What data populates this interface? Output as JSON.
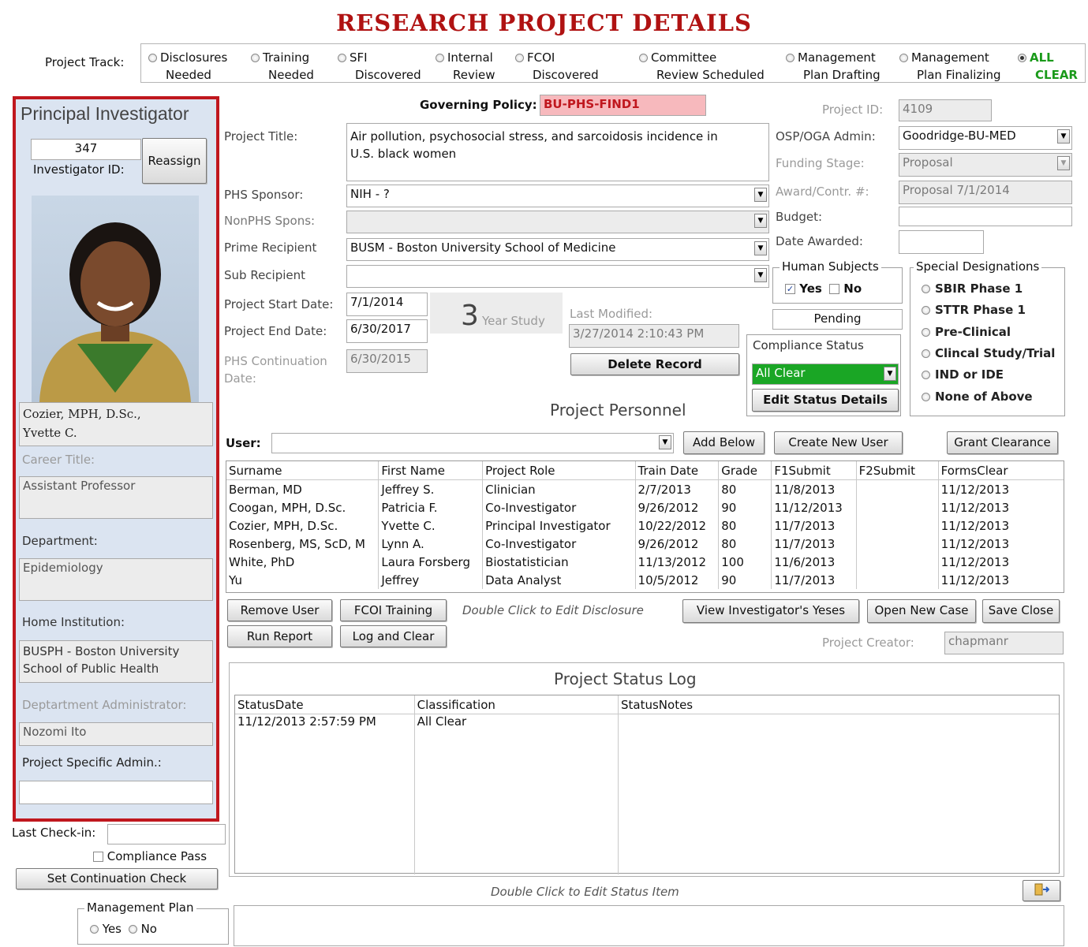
{
  "title": "RESEARCH PROJECT DETAILS",
  "colors": {
    "title_red": "#b01212",
    "frame_red": "#c0171e",
    "panel_blue": "#dbe4f1",
    "policy_pink": "#f7b9bd",
    "status_green": "#1aa625",
    "clear_green": "#1a9a1a"
  },
  "track": {
    "label": "Project Track:",
    "items": [
      {
        "line1": "Disclosures",
        "line2": "Needed",
        "selected": false
      },
      {
        "line1": "Training",
        "line2": "Needed",
        "selected": false
      },
      {
        "line1": "SFI",
        "line2": "Discovered",
        "selected": false
      },
      {
        "line1": "Internal",
        "line2": "Review",
        "selected": false
      },
      {
        "line1": "FCOI",
        "line2": "Discovered",
        "selected": false
      },
      {
        "line1": "Committee",
        "line2": "Review Scheduled",
        "selected": false
      },
      {
        "line1": "Management",
        "line2": "Plan Drafting",
        "selected": false
      },
      {
        "line1": "Management",
        "line2": "Plan Finalizing",
        "selected": false
      },
      {
        "line1": "ALL",
        "line2": "CLEAR",
        "selected": true
      }
    ]
  },
  "pi": {
    "heading": "Principal Investigator",
    "investigator_id": "347",
    "investigator_id_label": "Investigator ID:",
    "reassign": "Reassign",
    "name_line1": "Cozier, MPH, D.Sc.,",
    "name_line2": "Yvette C.",
    "career_title_label": "Career Title:",
    "career_title": "Assistant Professor",
    "department_label": "Department:",
    "department": "Epidemiology",
    "home_institution_label": "Home Institution:",
    "home_institution_line1": "BUSPH - Boston University",
    "home_institution_line2": "School of Public Health",
    "dept_admin_label": "Deptartment Administrator:",
    "dept_admin": "Nozomi Ito",
    "project_admin_label": "Project Specific Admin.:",
    "project_admin": ""
  },
  "left_footer": {
    "last_checkin_label": "Last Check-in:",
    "last_checkin": "",
    "compliance_pass": "Compliance Pass",
    "set_continuation": "Set Continuation Check",
    "mgmt_plan_legend": "Management Plan",
    "yes": "Yes",
    "no": "No"
  },
  "policy": {
    "label": "Governing Policy:",
    "value": "BU-PHS-FIND1"
  },
  "project": {
    "id_label": "Project ID:",
    "id": "4109",
    "title_label": "Project Title:",
    "title_line1": "Air pollution, psychosocial stress, and sarcoidosis incidence in",
    "title_line2": "U.S. black women",
    "phs_sponsor_label": "PHS Sponsor:",
    "phs_sponsor": "NIH - ?",
    "nonphs_label": "NonPHS Spons:",
    "nonphs": "",
    "prime_label": "Prime Recipient",
    "prime": "BUSM - Boston University School of Medicine",
    "sub_label": "Sub Recipient",
    "sub": "",
    "start_label": "Project Start Date:",
    "start": "7/1/2014",
    "end_label": "Project End Date:",
    "end": "6/30/2017",
    "cont_label_1": "PHS Continuation",
    "cont_label_2": "Date:",
    "cont": "6/30/2015",
    "years": "3",
    "years_label": "Year Study",
    "last_modified_label": "Last Modified:",
    "last_modified": "3/27/2014 2:10:43 PM",
    "delete": "Delete Record"
  },
  "admin": {
    "osp_label": "OSP/OGA Admin:",
    "osp": "Goodridge-BU-MED",
    "funding_label": "Funding Stage:",
    "funding": "Proposal",
    "award_label": "Award/Contr. #:",
    "award": "Proposal 7/1/2014",
    "budget_label": "Budget:",
    "budget": "",
    "awarded_label": "Date Awarded:",
    "awarded": ""
  },
  "human_subjects": {
    "legend": "Human Subjects",
    "yes": "Yes",
    "no": "No",
    "yes_checked": true,
    "no_checked": false,
    "status": "Pending"
  },
  "compliance": {
    "legend": "Compliance Status",
    "value": "All Clear",
    "edit": "Edit Status Details"
  },
  "special": {
    "legend": "Special Designations",
    "items": [
      "SBIR Phase 1",
      "STTR Phase 1",
      "Pre-Clinical",
      "Clincal Study/Trial",
      "IND or IDE",
      "None of Above"
    ]
  },
  "personnel": {
    "heading": "Project Personnel",
    "user_label": "User:",
    "user": "",
    "add_below": "Add Below",
    "create_user": "Create New User",
    "grant": "Grant Clearance",
    "columns": [
      "Surname",
      "First Name",
      "Project Role",
      "Train Date",
      "Grade",
      "F1Submit",
      "F2Submit",
      "FormsClear"
    ],
    "rows": [
      [
        "Berman, MD",
        "Jeffrey S.",
        "Clinician",
        "2/7/2013",
        "80",
        "11/8/2013",
        "",
        "11/12/2013"
      ],
      [
        "Coogan, MPH, D.Sc.",
        "Patricia F.",
        "Co-Investigator",
        "9/26/2012",
        "90",
        "11/12/2013",
        "",
        "11/12/2013"
      ],
      [
        "Cozier, MPH, D.Sc.",
        "Yvette C.",
        "Principal Investigator",
        "10/22/2012",
        "80",
        "11/7/2013",
        "",
        "11/12/2013"
      ],
      [
        "Rosenberg, MS, ScD, M",
        "Lynn A.",
        "Co-Investigator",
        "9/26/2012",
        "80",
        "11/7/2013",
        "",
        "11/12/2013"
      ],
      [
        "White, PhD",
        "Laura Forsberg",
        "Biostatistician",
        "11/13/2012",
        "100",
        "11/6/2013",
        "",
        "11/12/2013"
      ],
      [
        "Yu",
        "Jeffrey",
        "Data Analyst",
        "10/5/2012",
        "90",
        "11/7/2013",
        "",
        "11/12/2013"
      ]
    ],
    "remove": "Remove User",
    "fcoi": "FCOI Training",
    "hint": "Double Click to Edit Disclosure",
    "view_yeses": "View Investigator's Yeses",
    "open_case": "Open New Case",
    "save_close": "Save Close",
    "run_report": "Run Report",
    "log_clear": "Log and Clear",
    "creator_label": "Project Creator:",
    "creator": "chapmanr"
  },
  "status_log": {
    "heading": "Project Status Log",
    "columns": [
      "StatusDate",
      "Classification",
      "StatusNotes"
    ],
    "rows": [
      [
        "11/12/2013 2:57:59 PM",
        "All Clear",
        ""
      ]
    ],
    "hint": "Double Click to Edit Status Item"
  },
  "icons": {
    "exit": "exit-door-icon",
    "dropdown": "chevron-down-icon"
  }
}
